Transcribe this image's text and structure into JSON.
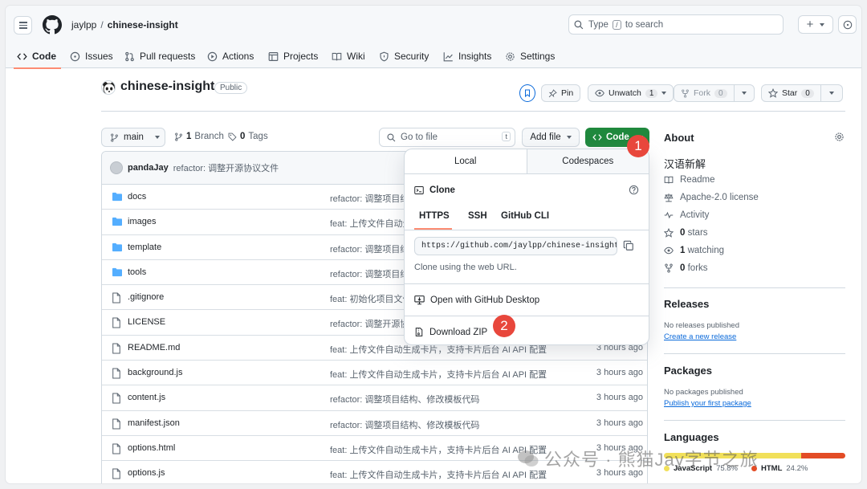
{
  "header": {
    "owner": "jaylpp",
    "separator": "/",
    "repo": "chinese-insight",
    "search_prefix": "Type",
    "search_key": "/",
    "search_suffix": "to search"
  },
  "nav_tabs": [
    {
      "label": "Code",
      "icon": "code-icon"
    },
    {
      "label": "Issues",
      "icon": "issue-icon"
    },
    {
      "label": "Pull requests",
      "icon": "pull-request-icon"
    },
    {
      "label": "Actions",
      "icon": "play-icon"
    },
    {
      "label": "Projects",
      "icon": "table-icon"
    },
    {
      "label": "Wiki",
      "icon": "book-icon"
    },
    {
      "label": "Security",
      "icon": "shield-icon"
    },
    {
      "label": "Insights",
      "icon": "graph-icon"
    },
    {
      "label": "Settings",
      "icon": "gear-icon"
    }
  ],
  "repo_header": {
    "title": "chinese-insight",
    "visibility": "Public",
    "pin_label": "Pin",
    "watch_label": "Unwatch",
    "watch_count": "1",
    "fork_label": "Fork",
    "fork_count": "0",
    "star_label": "Star",
    "star_count": "0"
  },
  "file_nav": {
    "branch": "main",
    "branches_count": "1",
    "branches_label": "Branch",
    "tags_count": "0",
    "tags_label": "Tags",
    "goto_placeholder": "Go to file",
    "goto_key": "t",
    "add_file": "Add file",
    "code_button": "Code"
  },
  "latest_commit": {
    "author": "pandaJay",
    "message": "refactor: 调整开源协议文件"
  },
  "files": [
    {
      "name": "docs",
      "type": "dir",
      "message": "refactor: 调整项目结",
      "time": ""
    },
    {
      "name": "images",
      "type": "dir",
      "message": "feat: 上传文件自动生",
      "time": ""
    },
    {
      "name": "template",
      "type": "dir",
      "message": "refactor: 调整项目结",
      "time": ""
    },
    {
      "name": "tools",
      "type": "dir",
      "message": "refactor: 调整项目结",
      "time": ""
    },
    {
      "name": ".gitignore",
      "type": "file",
      "message": "feat: 初始化项目文件",
      "time": ""
    },
    {
      "name": "LICENSE",
      "type": "file",
      "message": "refactor: 调整开源协",
      "time": ""
    },
    {
      "name": "README.md",
      "type": "file",
      "message": "feat: 上传文件自动生成卡片，支持卡片后台 AI API 配置",
      "time": "3 hours ago"
    },
    {
      "name": "background.js",
      "type": "file",
      "message": "feat: 上传文件自动生成卡片，支持卡片后台 AI API 配置",
      "time": "3 hours ago"
    },
    {
      "name": "content.js",
      "type": "file",
      "message": "refactor: 调整项目结构、修改模板代码",
      "time": "3 hours ago"
    },
    {
      "name": "manifest.json",
      "type": "file",
      "message": "refactor: 调整项目结构、修改模板代码",
      "time": "3 hours ago"
    },
    {
      "name": "options.html",
      "type": "file",
      "message": "feat: 上传文件自动生成卡片，支持卡片后台 AI API 配置",
      "time": "3 hours ago"
    },
    {
      "name": "options.js",
      "type": "file",
      "message": "feat: 上传文件自动生成卡片，支持卡片后台 AI API 配置",
      "time": "3 hours ago"
    }
  ],
  "about": {
    "title": "About",
    "description": "汉语新解",
    "readme": "Readme",
    "license": "Apache-2.0 license",
    "activity": "Activity",
    "stars_count": "0",
    "stars_label": "stars",
    "watching_count": "1",
    "watching_label": "watching",
    "forks_count": "0",
    "forks_label": "forks"
  },
  "releases": {
    "title": "Releases",
    "empty": "No releases published",
    "link": "Create a new release"
  },
  "packages": {
    "title": "Packages",
    "empty": "No packages published",
    "link": "Publish your first package"
  },
  "languages": {
    "title": "Languages",
    "items": [
      {
        "name": "JavaScript",
        "percent": "75.8%",
        "value": 75.8,
        "color": "#f1e05a"
      },
      {
        "name": "HTML",
        "percent": "24.2%",
        "value": 24.2,
        "color": "#e34c26"
      }
    ]
  },
  "clone_dropdown": {
    "tab_local": "Local",
    "tab_codespaces": "Codespaces",
    "clone_title": "Clone",
    "protocols": [
      "HTTPS",
      "SSH",
      "GitHub CLI"
    ],
    "url": "https://github.com/jaylpp/chinese-insight.git",
    "url_note": "Clone using the web URL.",
    "open_desktop": "Open with GitHub Desktop",
    "download_zip": "Download ZIP"
  },
  "step_badges": [
    "1",
    "2"
  ],
  "watermark": "公众号 · 熊猫Jay字节之旅",
  "colors": {
    "accent_green": "#1f883d",
    "tab_underline": "#fd8c73",
    "step_badge": "#e8473c",
    "folder_blue": "#54aeff",
    "link_blue": "#0969da"
  }
}
